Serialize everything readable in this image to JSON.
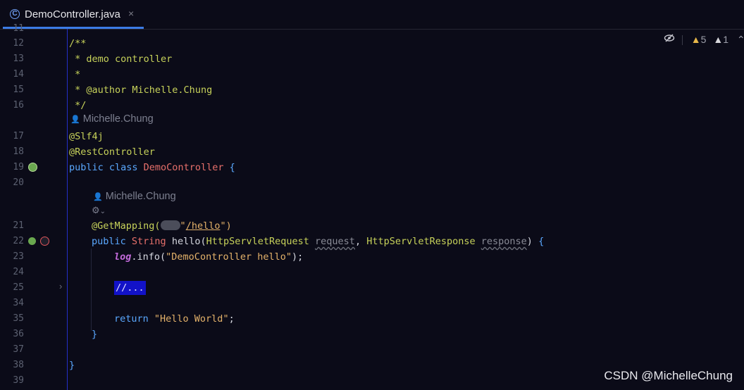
{
  "tab": {
    "label": "DemoController.java",
    "icon": "class-icon",
    "close": "×"
  },
  "editor": {
    "line_numbers": [
      "11",
      "12",
      "13",
      "14",
      "15",
      "16",
      "17",
      "18",
      "19",
      "20",
      "21",
      "22",
      "23",
      "24",
      "25",
      "34",
      "35",
      "36",
      "37",
      "38",
      "39"
    ],
    "doc": {
      "l12": "/**",
      "l13": " * demo controller",
      "l14": " *",
      "l15_tag": " * @author",
      "l15_name": " Michelle.Chung",
      "l16": " */"
    },
    "author_hint_1": "Michelle.Chung",
    "author_hint_2": "Michelle.Chung",
    "l17": "@Slf4j",
    "l18": "@RestController",
    "l19": {
      "kw": "public class ",
      "cls": "DemoController",
      "brace": " {"
    },
    "l21": {
      "ann": "@GetMapping(",
      "url": "/hello",
      "close": "\")"
    },
    "l22": {
      "kw": "public ",
      "type": "String",
      "method": " hello(",
      "ptype1": "HttpServletRequest ",
      "p1": "request",
      "comma": ", ",
      "ptype2": "HttpServletResponse ",
      "p2": "response",
      "close": ")",
      "brace": " {"
    },
    "l23": {
      "log": "log",
      "call": ".info(",
      "str": "\"DemoController hello\"",
      "end": ");"
    },
    "l25": "//...",
    "l35": {
      "kw": "return ",
      "str": "\"Hello World\"",
      "end": ";"
    },
    "l36": "}",
    "l38": "}"
  },
  "status": {
    "warnings": "5",
    "weak_warnings": "1"
  },
  "watermark": "CSDN @MichelleChung"
}
